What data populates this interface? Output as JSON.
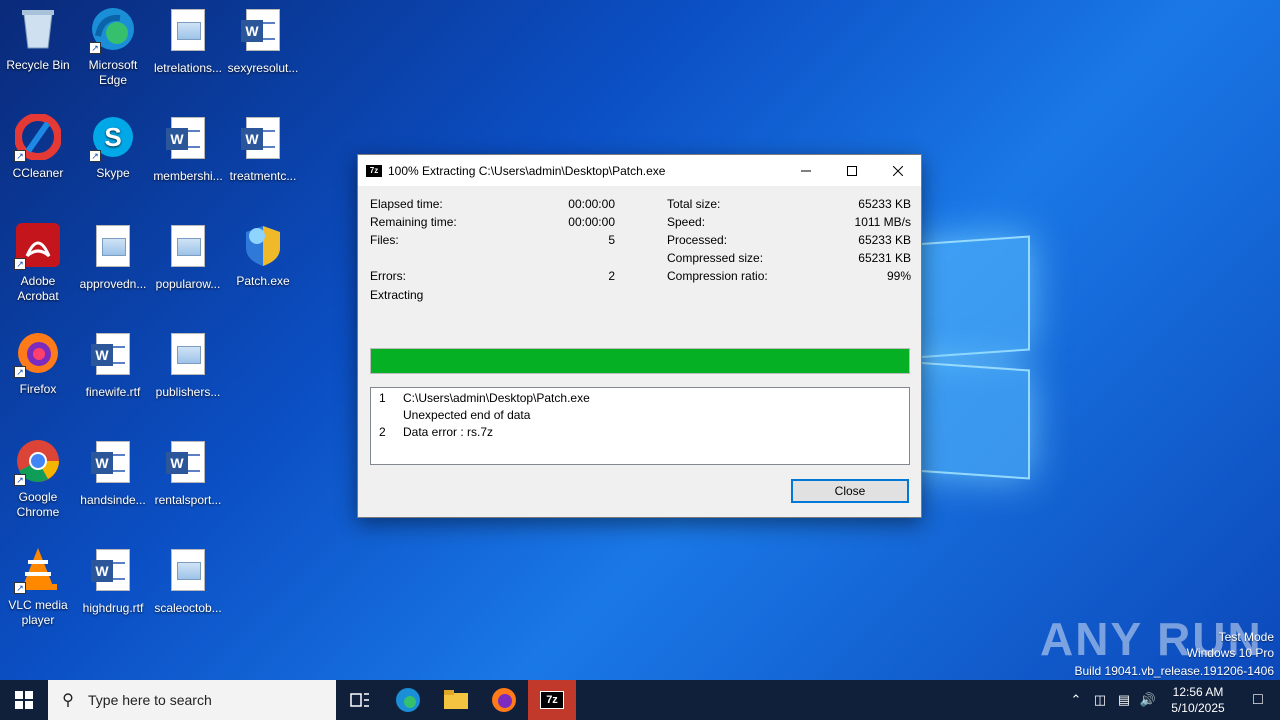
{
  "desktop": {
    "icons": [
      {
        "label": "Recycle Bin",
        "icon": "recycle-bin-icon"
      },
      {
        "label": "Microsoft Edge",
        "icon": "edge-icon"
      },
      {
        "label": "letrelations...",
        "icon": "image-file-icon"
      },
      {
        "label": "sexyresolut...",
        "icon": "word-doc-icon"
      },
      {
        "label": "CCleaner",
        "icon": "ccleaner-icon"
      },
      {
        "label": "Skype",
        "icon": "skype-icon"
      },
      {
        "label": "membershi...",
        "icon": "word-doc-icon"
      },
      {
        "label": "treatmentc...",
        "icon": "word-doc-icon"
      },
      {
        "label": "Adobe Acrobat",
        "icon": "acrobat-icon"
      },
      {
        "label": "approvedn...",
        "icon": "image-file-icon"
      },
      {
        "label": "popularow...",
        "icon": "image-file-icon"
      },
      {
        "label": "Patch.exe",
        "icon": "patch-exe-icon"
      },
      {
        "label": "Firefox",
        "icon": "firefox-icon"
      },
      {
        "label": "finewife.rtf",
        "icon": "word-doc-icon"
      },
      {
        "label": "publishers...",
        "icon": "image-file-icon"
      },
      {
        "label": "Google Chrome",
        "icon": "chrome-icon"
      },
      {
        "label": "handsinde...",
        "icon": "word-doc-icon"
      },
      {
        "label": "rentalsport...",
        "icon": "word-doc-icon"
      },
      {
        "label": "VLC media player",
        "icon": "vlc-icon"
      },
      {
        "label": "highdrug.rtf",
        "icon": "word-doc-icon"
      },
      {
        "label": "scaleoctob...",
        "icon": "image-file-icon"
      }
    ]
  },
  "dialog": {
    "app_icon": "7z",
    "title": "100% Extracting C:\\Users\\admin\\Desktop\\Patch.exe",
    "left_stats": [
      {
        "label": "Elapsed time:",
        "value": "00:00:00"
      },
      {
        "label": "Remaining time:",
        "value": "00:00:00"
      },
      {
        "label": "Files:",
        "value": "5"
      },
      {
        "label": "Errors:",
        "value": "2"
      }
    ],
    "right_stats": [
      {
        "label": "Total size:",
        "value": "65233 KB"
      },
      {
        "label": "Speed:",
        "value": "1011 MB/s"
      },
      {
        "label": "Processed:",
        "value": "65233 KB"
      },
      {
        "label": "Compressed size:",
        "value": "65231 KB"
      },
      {
        "label": "Compression ratio:",
        "value": "99%"
      }
    ],
    "status": "Extracting",
    "progress_percent": 100,
    "progress_color": "#06b025",
    "log": [
      {
        "num": "1",
        "text": "C:\\Users\\admin\\Desktop\\Patch.exe"
      },
      {
        "num": "",
        "text": "Unexpected end of data"
      },
      {
        "num": "2",
        "text": "Data error : rs.7z"
      }
    ],
    "close_label": "Close"
  },
  "watermark": {
    "brand": "ANY RUN",
    "mode": "Test Mode",
    "edition": "Windows 10 Pro",
    "build": "Build 19041.vb_release.191206-1406"
  },
  "taskbar": {
    "search_placeholder": "Type here to search",
    "time": "12:56 AM",
    "date": "5/10/2025"
  }
}
